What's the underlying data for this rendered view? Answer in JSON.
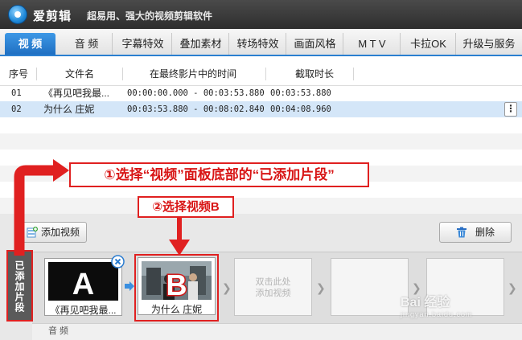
{
  "title_bar": {
    "app_name": "爱剪辑",
    "slogan": "超易用、强大的视频剪辑软件"
  },
  "tabs": [
    {
      "label": "视 频",
      "active": true
    },
    {
      "label": "音 频"
    },
    {
      "label": "字幕特效"
    },
    {
      "label": "叠加素材"
    },
    {
      "label": "转场特效"
    },
    {
      "label": "画面风格"
    },
    {
      "label": "M T V"
    },
    {
      "label": "卡拉OK"
    },
    {
      "label": "升级与服务"
    }
  ],
  "table": {
    "headers": [
      "序号",
      "文件名",
      "在最终影片中的时间",
      "截取时长"
    ],
    "rows": [
      {
        "index": "01",
        "name": "《再见吧我最...",
        "range": "00:00:00.000 - 00:03:53.880",
        "duration": "00:03:53.880"
      },
      {
        "index": "02",
        "name": "为什么 庄妮",
        "range": "00:03:53.880 - 00:08:02.840",
        "duration": "00:04:08.960"
      }
    ],
    "more_button": "⋮"
  },
  "panel": {
    "add_video": "添加视频",
    "delete": "删除",
    "side_label": "已添加片段",
    "clips": [
      {
        "letter": "A",
        "caption": "《再见吧我最..."
      },
      {
        "letter": "B",
        "caption": "为什么 庄妮"
      }
    ],
    "empty_slot": "双击此处\n添加视频",
    "audio_label": "音 频"
  },
  "annotations": {
    "step1": "①选择“视频”面板底部的“已添加片段”",
    "step2": "②选择视频B"
  },
  "watermark": {
    "main": "Bai 经验",
    "sub": "jingyan.baidu.com"
  },
  "colors": {
    "accent": "#2b7fd0",
    "annotation": "#e02020",
    "selected_row": "#d4e6f8"
  }
}
